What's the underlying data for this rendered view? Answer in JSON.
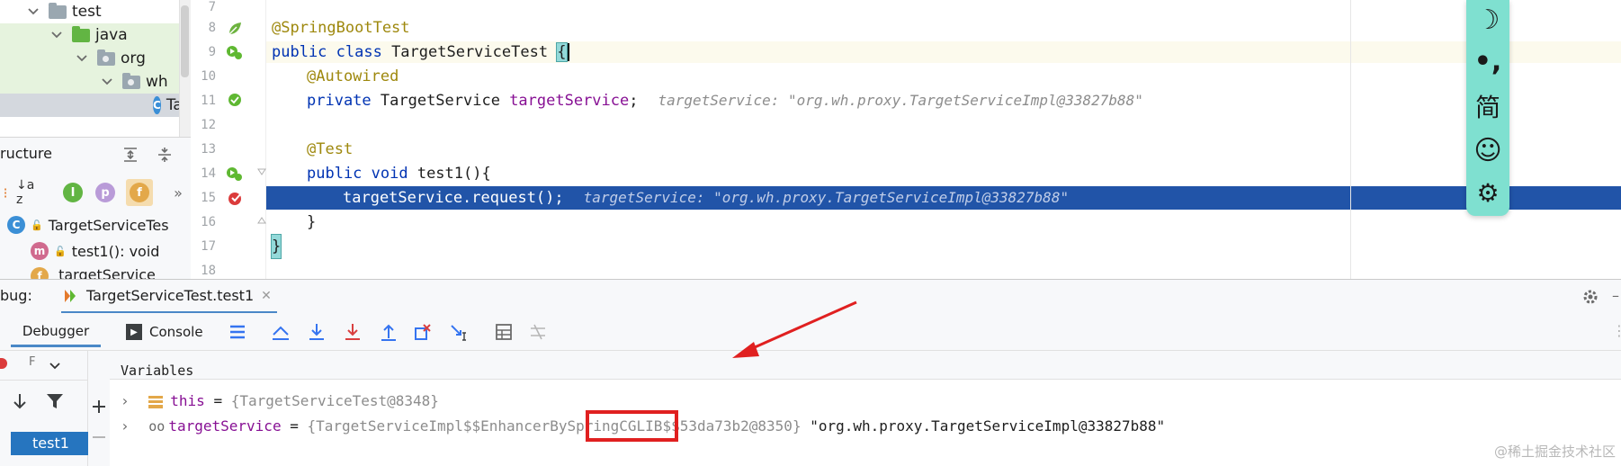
{
  "project_tree": {
    "items": [
      {
        "label": "test"
      },
      {
        "label": "java"
      },
      {
        "label": "org"
      },
      {
        "label": "wh"
      },
      {
        "label": "Ta"
      }
    ]
  },
  "structure": {
    "title": "ructure",
    "sort_alpha": "↓a z",
    "items": [
      {
        "label": "TargetServiceTes"
      },
      {
        "label": "test1(): void"
      },
      {
        "label": "targetService"
      }
    ]
  },
  "editor": {
    "lines": [
      {
        "no": "7",
        "text": ""
      },
      {
        "no": "8",
        "text": "@SpringBootTest"
      },
      {
        "no": "9",
        "kw": "public class ",
        "name": "TargetServiceTest ",
        "brace": "{"
      },
      {
        "no": "10",
        "text": "@Autowired"
      },
      {
        "no": "11",
        "kw": "private ",
        "type": "TargetService ",
        "field": "targetService",
        "end": ";",
        "hint": "targetService: \"org.wh.proxy.TargetServiceImpl@33827b88\""
      },
      {
        "no": "12",
        "text": ""
      },
      {
        "no": "13",
        "text": "@Test"
      },
      {
        "no": "14",
        "kw": "public void ",
        "name": "test1(){"
      },
      {
        "no": "15",
        "code": "targetService.request();",
        "hint": "targetService: \"org.wh.proxy.TargetServiceImpl@33827b88\""
      },
      {
        "no": "16",
        "text": "}"
      },
      {
        "no": "17",
        "text": "}"
      },
      {
        "no": "18",
        "text": ""
      }
    ]
  },
  "debug": {
    "label": "bug:",
    "session_tab": "TargetServiceTest.test1",
    "tabs": {
      "debugger": "Debugger",
      "console": "Console"
    },
    "frames_label": "F",
    "variables_label": "Variables",
    "frame_item": "test1",
    "variables": [
      {
        "name": "this",
        "eq": " = ",
        "value": "{TargetServiceTest@8348}",
        "str": ""
      },
      {
        "name": "targetService",
        "eq": " = ",
        "value_pre": "{TargetServiceImpl$$EnhancerBySpr",
        "value_hl": "ingCGLIB$",
        "value_post": "$53da73b2@8350}",
        "str": " \"org.wh.proxy.TargetServiceImpl@33827b88\""
      }
    ]
  },
  "ime": {
    "moon": "☽",
    "punct": "•,",
    "simplified": "简",
    "emoji": "☺",
    "settings": "⚙"
  },
  "watermark": "@稀土掘金技术社区",
  "colors": {
    "selection_blue": "#2154a8",
    "annotation_box": "#e02020",
    "arrow": "#e02020",
    "ime_bg": "#7fe0d0"
  }
}
